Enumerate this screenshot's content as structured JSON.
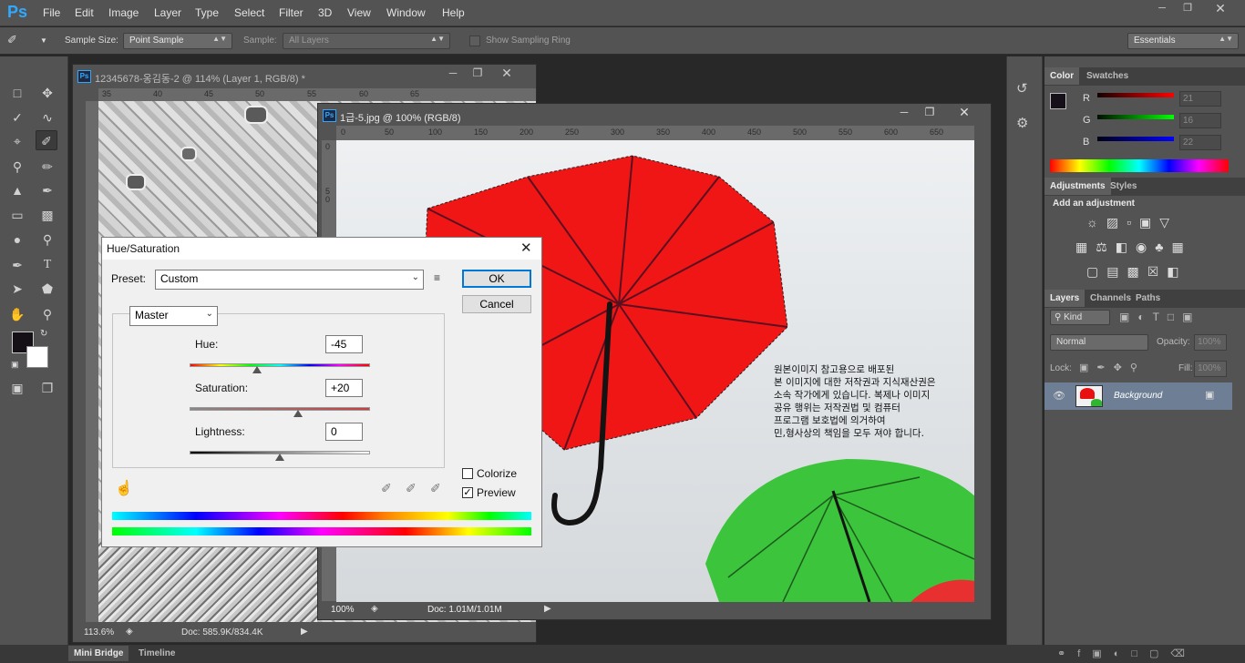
{
  "app": {
    "logo": "Ps"
  },
  "menu": [
    "File",
    "Edit",
    "Image",
    "Layer",
    "Type",
    "Select",
    "Filter",
    "3D",
    "View",
    "Window",
    "Help"
  ],
  "options": {
    "sample_size_label": "Sample Size:",
    "sample_size_value": "Point Sample",
    "sample_label": "Sample:",
    "sample_value": "All Layers",
    "sampling_ring_label": "Show Sampling Ring",
    "workspace": "Essentials"
  },
  "doc_back": {
    "title": "12345678-옹김동-2 @ 114% (Layer 1, RGB/8) *",
    "ruler_ticks": [
      "35",
      "40",
      "45",
      "50",
      "55",
      "60",
      "65"
    ],
    "zoom": "113.6%",
    "doc_info": "Doc: 585.9K/834.4K"
  },
  "doc_front": {
    "title": "1급-5.jpg @ 100% (RGB/8)",
    "ruler_ticks": [
      "0",
      "50",
      "100",
      "150",
      "200",
      "250",
      "300",
      "350",
      "400",
      "450",
      "500",
      "550",
      "600",
      "650"
    ],
    "vruler_ticks": [
      "0",
      "5 0"
    ],
    "zoom": "100%",
    "doc_info": "Doc: 1.01M/1.01M",
    "watermark": [
      "원본이미지 참고용으로 배포된",
      "본 이미지에 대한 저작권과 지식재산권은",
      "소속 작가에게 있습니다. 복제나 이미지",
      "공유 행위는 저작권법 및 컴퓨터",
      "프로그램 보호법에 의거하여",
      "민,형사상의 책임을 모두 져야 합니다."
    ]
  },
  "dialog": {
    "title": "Hue/Saturation",
    "preset_label": "Preset:",
    "preset_value": "Custom",
    "ok": "OK",
    "cancel": "Cancel",
    "channel": "Master",
    "hue_label": "Hue:",
    "hue_value": "-45",
    "saturation_label": "Saturation:",
    "saturation_value": "+20",
    "lightness_label": "Lightness:",
    "lightness_value": "0",
    "colorize_label": "Colorize",
    "colorize_checked": false,
    "preview_label": "Preview",
    "preview_checked": true,
    "hue_range": [
      -180,
      180
    ],
    "saturation_range": [
      -100,
      100
    ],
    "lightness_range": [
      -100,
      100
    ]
  },
  "color_panel": {
    "tabs": [
      "Color",
      "Swatches"
    ],
    "r_label": "R",
    "r_value": "21",
    "g_label": "G",
    "g_value": "16",
    "b_label": "B",
    "b_value": "22"
  },
  "adjustments_panel": {
    "tabs": [
      "Adjustments",
      "Styles"
    ],
    "heading": "Add an adjustment"
  },
  "layers_panel": {
    "tabs": [
      "Layers",
      "Channels",
      "Paths"
    ],
    "kind": "Kind",
    "blend_mode": "Normal",
    "opacity_label": "Opacity:",
    "opacity_value": "100%",
    "lock_label": "Lock:",
    "fill_label": "Fill:",
    "fill_value": "100%",
    "layer_name": "Background"
  },
  "bottom": {
    "tabs": [
      "Mini Bridge",
      "Timeline"
    ]
  },
  "colors": {
    "accent": "#31a8ff",
    "panel_bg": "#535353",
    "workspace_bg": "#282828",
    "red_umbrella": "#f01616",
    "green_umbrella": "#3cc43c"
  }
}
